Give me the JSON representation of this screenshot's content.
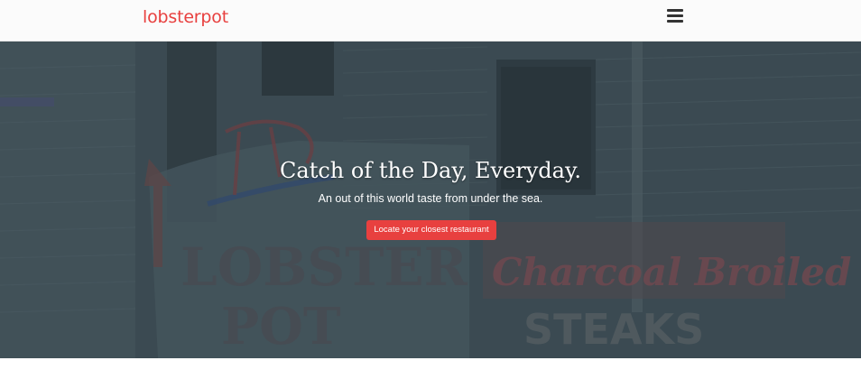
{
  "navbar": {
    "brand": "lobsterpot",
    "menu_icon": "hamburger-menu-icon"
  },
  "hero": {
    "title": "Catch of the Day, Everyday.",
    "subtitle": "An out of this world taste from under the sea.",
    "cta_label": "Locate your closest restaurant",
    "sign_text_left_top": "LOBSTER",
    "sign_text_left_bottom": "POT",
    "sign_text_right_script": "Charcoal Broiled",
    "sign_text_right_bottom": "STEAKS"
  },
  "colors": {
    "brand": "#e8403f",
    "overlay": "#3d4c53",
    "navbar_bg": "#fbfbfb"
  }
}
